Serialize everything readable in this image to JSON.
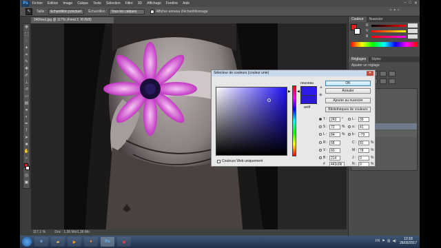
{
  "menubar": {
    "logo": "Ps",
    "items": [
      "Fichier",
      "Edition",
      "Image",
      "Calque",
      "Texte",
      "Sélection",
      "Filtre",
      "3D",
      "Affichage",
      "Fenêtre",
      "Aide"
    ]
  },
  "options": {
    "size_label": "Taille :",
    "size_value": "Échantillon ponctuel",
    "sample_label": "Échantillon :",
    "sample_value": "Tous les calques",
    "ring_label": "Afficher anneau d'échantillonnage"
  },
  "document": {
    "tab_title": "240fond.jpg @ 117% (Fond 2, RVB/8)",
    "status_zoom": "117,1 %",
    "status_doc": "Doc : 1,36 Mo/1,36 Mo"
  },
  "panels": {
    "color_tabs": [
      "Couleur",
      "Nuancier"
    ],
    "adjust_tabs": [
      "Réglages",
      "Styles"
    ],
    "adjust_title": "Ajouter un réglage",
    "slider_labels": [
      "R",
      "V",
      "B"
    ]
  },
  "dialog": {
    "title": "Sélecteur de couleurs (couleur unie)",
    "new_label": "nouveau",
    "current_label": "actif",
    "ok_label": "OK",
    "cancel_label": "Annuler",
    "add_swatch_label": "Ajouter au nuancier",
    "libraries_label": "Bibliothèques de couleurs",
    "web_only_label": "Couleurs Web uniquement",
    "new_color": "#2d1ce9",
    "hex_label": "#",
    "hex_value": "443c0b",
    "fields": {
      "H": {
        "label": "T :",
        "value": "243",
        "unit": "°"
      },
      "S": {
        "label": "S :",
        "value": "72",
        "unit": "%"
      },
      "Br": {
        "label": "L :",
        "value": "84",
        "unit": "%"
      },
      "R": {
        "label": "R :",
        "value": "68",
        "unit": ""
      },
      "G": {
        "label": "V :",
        "value": "60",
        "unit": ""
      },
      "B": {
        "label": "B :",
        "value": "214",
        "unit": ""
      },
      "L": {
        "label": "L :",
        "value": "39",
        "unit": ""
      },
      "a": {
        "label": "a :",
        "value": "41",
        "unit": ""
      },
      "b": {
        "label": "b :",
        "value": "-79",
        "unit": ""
      },
      "C": {
        "label": "C :",
        "value": "81",
        "unit": "%"
      },
      "M": {
        "label": "M :",
        "value": "78",
        "unit": "%"
      },
      "Y": {
        "label": "J :",
        "value": "0",
        "unit": "%"
      },
      "K": {
        "label": "N :",
        "value": "0",
        "unit": "%"
      }
    }
  },
  "taskbar": {
    "time": "12:18",
    "date": "28/05/2017",
    "lang": "FR",
    "ps_label": "Ps"
  }
}
